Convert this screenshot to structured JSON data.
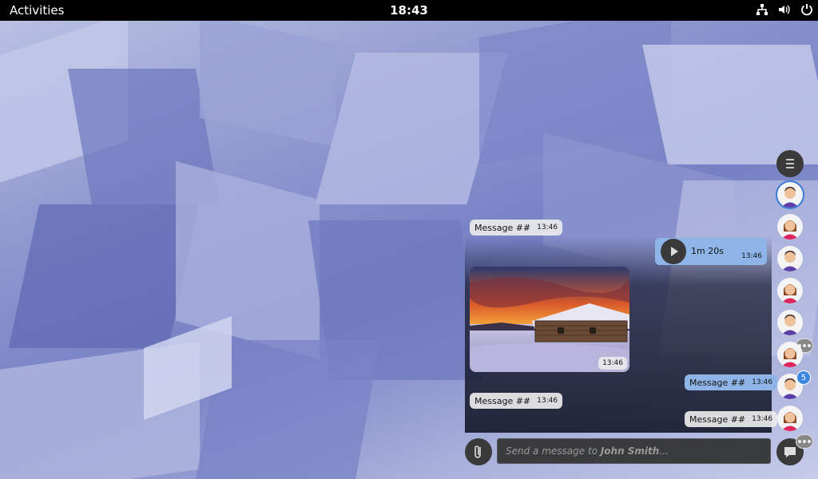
{
  "topbar": {
    "activities": "Activities",
    "clock": "18:43"
  },
  "chat": {
    "messages": [
      {
        "text": "Message ##",
        "time": "13:46"
      },
      {
        "duration": "1m 20s",
        "time": "13:46"
      },
      {
        "time": "13:46"
      },
      {
        "text": "Message ##",
        "time": "13:46"
      },
      {
        "text": "Message ##",
        "time": "13:46"
      },
      {
        "text": "Message ##",
        "time": "13:46"
      }
    ],
    "input_placeholder": "Send a message to ",
    "input_recipient": "John Smith",
    "input_ellipsis": "..."
  },
  "contacts": {
    "badge_count": "5"
  }
}
